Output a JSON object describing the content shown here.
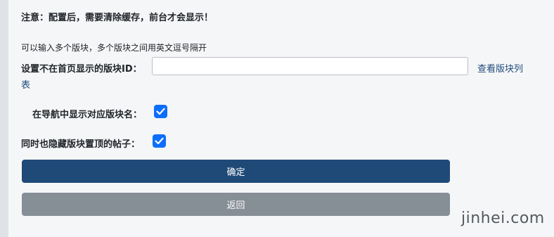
{
  "notice": "注意：配置后，需要清除缓存，前台才会显示！",
  "form": {
    "hint": "可以输入多个版块，多个版块之间用英文逗号隔开",
    "blocks_label": "设置不在首页显示的版块ID：",
    "blocks_value": "",
    "view_list_link_line1": "查看版块列",
    "view_list_link_line2": "表",
    "nav_label": "在导航中显示对应版块名：",
    "nav_checked": true,
    "hide_label": "同时也隐藏版块置顶的帖子：",
    "hide_checked": true
  },
  "buttons": {
    "confirm": "确定",
    "back": "返回"
  },
  "watermark": "jinhei.com",
  "colors": {
    "accent": "#0d6efd",
    "confirm_bg": "#1f4a78",
    "back_bg": "#868e96",
    "link": "#1f4a7a"
  }
}
